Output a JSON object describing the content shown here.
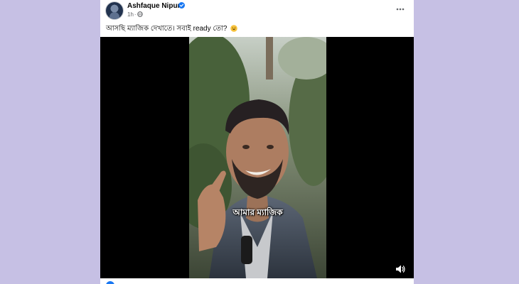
{
  "post": {
    "author": "Ashfaque Nipun",
    "verified": true,
    "timestamp": "1h",
    "meta_separator": "·",
    "privacy_icon": "globe-icon",
    "more_icon": "more-options-icon",
    "caption": "আসছি ম্যাজিক দেখাতে। সবাই ready তো?",
    "caption_emoji": "grinning-face-emoji"
  },
  "video": {
    "subtitle": "আমার ম্যাজিক",
    "volume_icon": "volume-icon",
    "muted": false
  },
  "colors": {
    "page_background": "#c6c0e4",
    "card_background": "#ffffff",
    "verified_blue": "#1877f2",
    "meta_text": "#65676b",
    "primary_text": "#050505",
    "video_letterbox": "#000000"
  }
}
